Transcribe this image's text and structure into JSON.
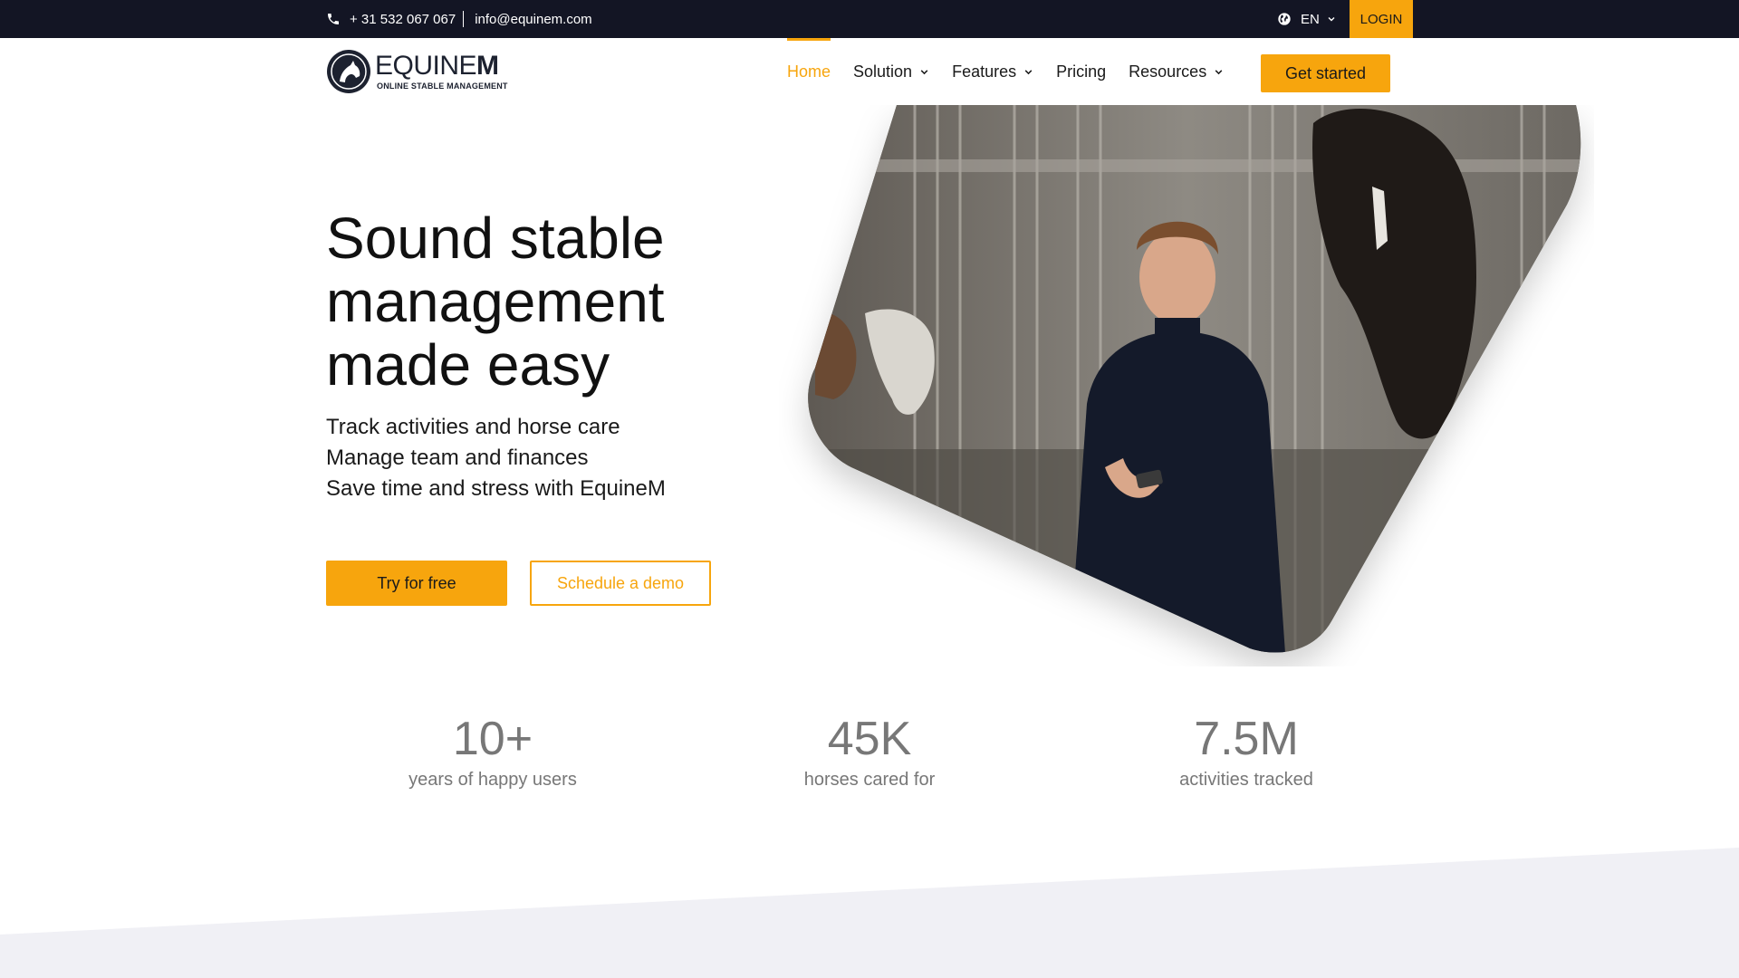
{
  "topbar": {
    "phone": "+ 31 532 067 067",
    "email": "info@equinem.com",
    "language": "EN",
    "login_label": "LOGIN"
  },
  "header": {
    "logo_brand_light": "EQUINE",
    "logo_brand_bold": "M",
    "logo_tagline": "ONLINE STABLE MANAGEMENT",
    "nav": [
      {
        "label": "Home",
        "active": true
      },
      {
        "label": "Solution",
        "dropdown": true
      },
      {
        "label": "Features",
        "dropdown": true
      },
      {
        "label": "Pricing"
      },
      {
        "label": "Resources",
        "dropdown": true
      }
    ],
    "cta_label": "Get started"
  },
  "hero": {
    "title": "Sound stable management made easy",
    "subtitle_lines": [
      "Track activities and horse care",
      "Manage team and finances",
      "Save time and stress with EquineM"
    ],
    "primary_button": "Try for free",
    "secondary_button": "Schedule a demo"
  },
  "stats": [
    {
      "value": "10+",
      "label": "years of happy users"
    },
    {
      "value": "45K",
      "label": "horses cared for"
    },
    {
      "value": "7.5M",
      "label": "activities tracked"
    }
  ],
  "colors": {
    "accent": "#f7a50d",
    "topbar_bg": "#131524",
    "text_dark": "#111111",
    "stat_gray": "#777777",
    "band_bg": "#f0f0f5"
  },
  "icons": [
    "phone-icon",
    "globe-icon",
    "chevron-down-icon",
    "horse-logo-icon"
  ]
}
